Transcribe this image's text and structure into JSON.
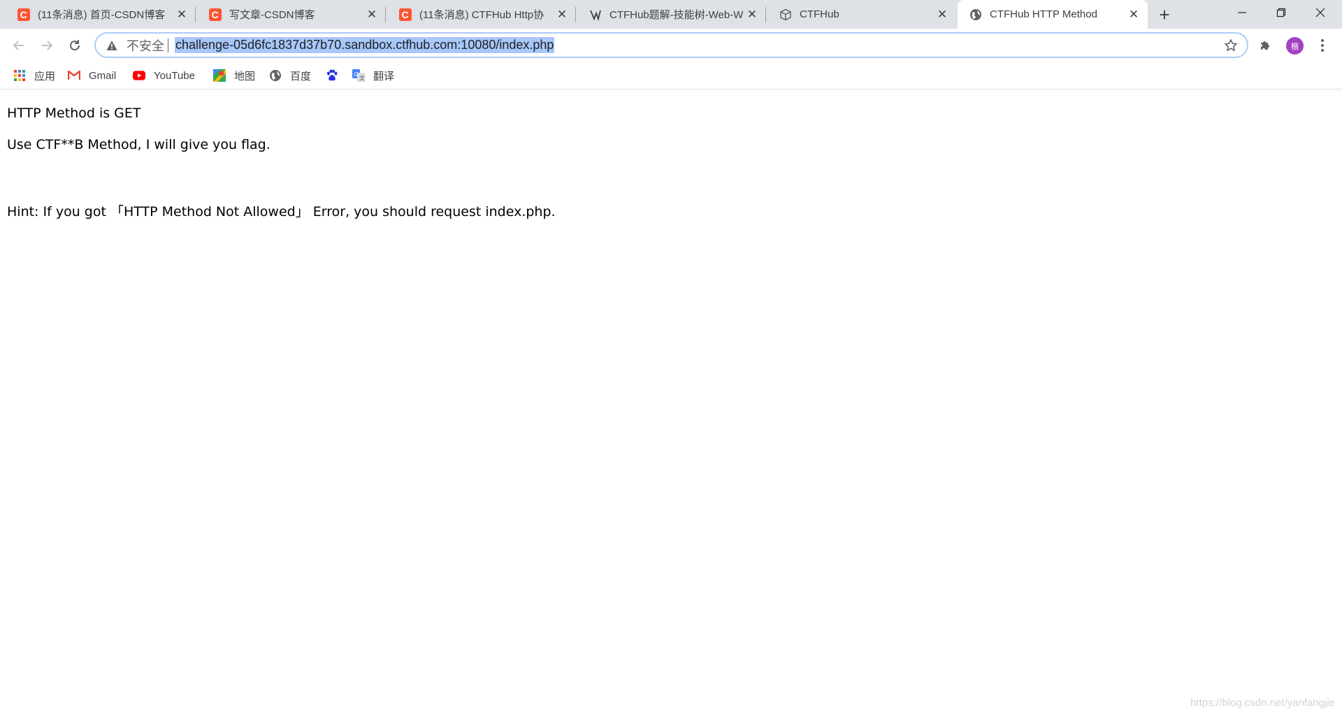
{
  "tabs": [
    {
      "title": "(11条消息) 首页-CSDN博客",
      "icon": "csdn-icon"
    },
    {
      "title": "写文章-CSDN博客",
      "icon": "csdn-icon"
    },
    {
      "title": "(11条消息) CTFHub Http协",
      "icon": "csdn-icon"
    },
    {
      "title": "CTFHub题解-技能树-Web-W",
      "icon": "ctfhub-writeup-icon"
    },
    {
      "title": "CTFHub",
      "icon": "ctfhub-cube-icon"
    },
    {
      "title": "CTFHub HTTP Method",
      "icon": "globe-icon",
      "active": true
    }
  ],
  "omnibox": {
    "security_label": "不安全",
    "url": "challenge-05d6fc1837d37b70.sandbox.ctfhub.com:10080/index.php"
  },
  "profile": {
    "avatar_text": "楷"
  },
  "bookmarks": [
    {
      "label": "应用",
      "icon": "apps-grid-icon"
    },
    {
      "label": "Gmail",
      "icon": "gmail-icon"
    },
    {
      "label": "YouTube",
      "icon": "youtube-icon"
    },
    {
      "label": "地图",
      "icon": "maps-icon"
    },
    {
      "label": "百度",
      "icon": "globe-icon"
    },
    {
      "label": "",
      "icon": "baidu-paw-icon"
    },
    {
      "label": "翻译",
      "icon": "translate-icon"
    }
  ],
  "page": {
    "line1": "HTTP Method is GET",
    "line2": "Use CTF**B Method, I will give you flag.",
    "hint": "Hint: If you got 「HTTP Method Not Allowed」 Error, you should request index.php."
  },
  "watermark": "https://blog.csdn.net/yanfangjie"
}
